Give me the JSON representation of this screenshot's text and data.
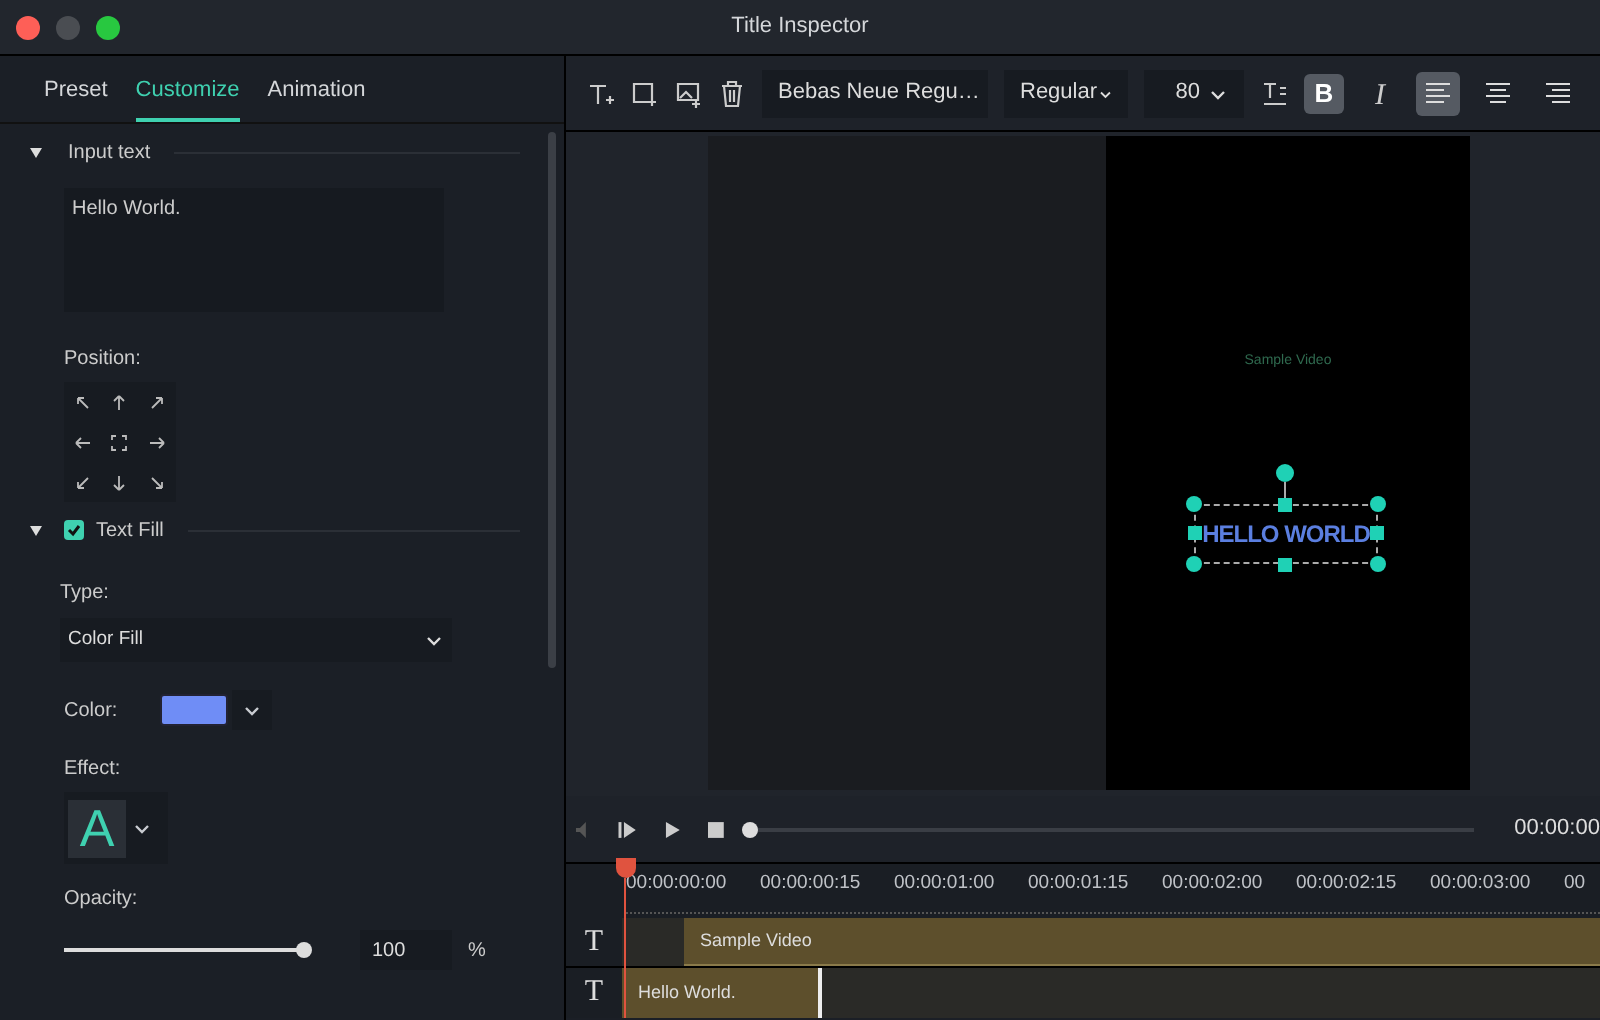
{
  "window": {
    "title": "Title Inspector"
  },
  "tabs": [
    {
      "label": "Preset",
      "selected": false
    },
    {
      "label": "Customize",
      "selected": true
    },
    {
      "label": "Animation",
      "selected": false
    }
  ],
  "input_section": {
    "title": "Input text",
    "expanded": true,
    "value": "Hello World."
  },
  "position": {
    "label": "Position:"
  },
  "text_fill": {
    "title": "Text Fill",
    "expanded": true,
    "checked": true,
    "type_label": "Type:",
    "type_value": "Color Fill",
    "color_label": "Color:",
    "effect_label": "Effect:",
    "effect_glyph": "A",
    "opacity_label": "Opacity:",
    "opacity": {
      "level": 1,
      "value": "100",
      "unit": "%"
    }
  },
  "toolbar": {
    "font": "Bebas Neue Regu…",
    "style": "Regular",
    "size": "80",
    "bold": true,
    "italic": false,
    "bold_glyph": "B",
    "italic_glyph": "I",
    "align": [
      {
        "kind": "left",
        "selected": true
      },
      {
        "kind": "center",
        "selected": false
      },
      {
        "kind": "right",
        "selected": false
      }
    ]
  },
  "preview": {
    "caption": "Sample Video",
    "title": "HELLO WORLD"
  },
  "playback": {
    "level": 0,
    "time": "00:00:00"
  },
  "ruler": [
    "00:00:00:00",
    "00:00:00:15",
    "00:00:01:00",
    "00:00:01:15",
    "00:00:02:00",
    "00:00:02:15",
    "00:00:03:00",
    "00"
  ],
  "tracks": [
    {
      "icon": "T",
      "clip": "Sample Video"
    },
    {
      "icon": "T",
      "clip": "Hello World."
    }
  ]
}
